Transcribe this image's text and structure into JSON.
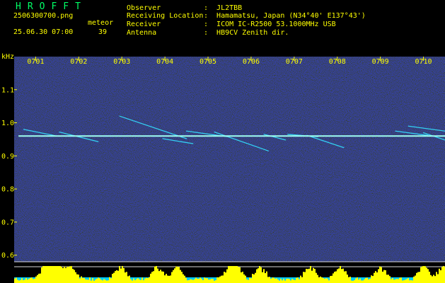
{
  "header": {
    "app_title": "HROFFT",
    "filename": "2506300700.png",
    "datetime": "25.06.30 07:00",
    "meteor_label": "meteor",
    "meteor_count": "39",
    "fields": [
      {
        "label": "Observer",
        "value": ":  JL2TBB"
      },
      {
        "label": "Receiving Location",
        "value": ":  Hamamatsu, Japan (N34°40' E137°43')"
      },
      {
        "label": "Receiver",
        "value": ":  ICOM IC-R2500 53.1000MHz USB"
      },
      {
        "label": "Antenna",
        "value": ":  HB9CV Zenith dir."
      }
    ]
  },
  "colors": {
    "background": "#000000",
    "plot_background": "#08082a",
    "header_text": "#ffff00",
    "title_text": "#00ff66",
    "carrier": "#9ffff0",
    "echo": "#33e0ff",
    "level": "#ffff00",
    "level_base": "#00ccff"
  },
  "chart_data": {
    "type": "heatmap",
    "title": "",
    "ylabel": "kHz",
    "x_ticks": [
      "0701",
      "0702",
      "0703",
      "0704",
      "0705",
      "0706",
      "0707",
      "0708",
      "0709",
      "0710"
    ],
    "x_range": [
      0.5,
      10.5
    ],
    "y_ticks": [
      {
        "label": "1.1",
        "value": 1.1
      },
      {
        "label": "1.0",
        "value": 1.0
      },
      {
        "label": "0.9",
        "value": 0.9
      },
      {
        "label": "0.8",
        "value": 0.8
      },
      {
        "label": "0.7",
        "value": 0.7
      },
      {
        "label": "0.6",
        "value": 0.6
      }
    ],
    "ylim": [
      0.58,
      1.2
    ],
    "carrier_freq": 0.96,
    "echoes": [
      {
        "x": [
          0.72,
          1.45
        ],
        "y": [
          0.98,
          0.961
        ]
      },
      {
        "x": [
          1.55,
          2.45
        ],
        "y": [
          0.972,
          0.943
        ]
      },
      {
        "x": [
          2.95,
          4.5
        ],
        "y": [
          1.02,
          0.952
        ]
      },
      {
        "x": [
          3.95,
          4.65
        ],
        "y": [
          0.952,
          0.937
        ]
      },
      {
        "x": [
          4.5,
          5.45
        ],
        "y": [
          0.975,
          0.958
        ]
      },
      {
        "x": [
          5.15,
          6.4
        ],
        "y": [
          0.972,
          0.915
        ]
      },
      {
        "x": [
          6.3,
          6.8
        ],
        "y": [
          0.965,
          0.948
        ]
      },
      {
        "x": [
          6.85,
          7.55
        ],
        "y": [
          0.965,
          0.958
        ]
      },
      {
        "x": [
          7.3,
          8.15
        ],
        "y": [
          0.962,
          0.925
        ]
      },
      {
        "x": [
          9.35,
          10.1
        ],
        "y": [
          0.975,
          0.962
        ]
      },
      {
        "x": [
          9.65,
          10.5
        ],
        "y": [
          0.99,
          0.975
        ]
      },
      {
        "x": [
          10.0,
          10.5
        ],
        "y": [
          0.97,
          0.948
        ]
      }
    ],
    "level_bursts": [
      1.2,
      1.35,
      1.5,
      1.8,
      2.95,
      3.8,
      4.25,
      5.5,
      5.65,
      6.2,
      7.35,
      8.05,
      9.0,
      10.0,
      10.45
    ]
  }
}
